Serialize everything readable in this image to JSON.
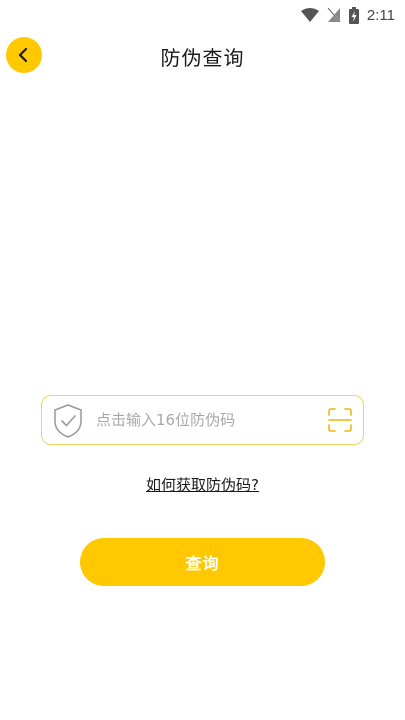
{
  "status_bar": {
    "time": "2:11",
    "icons": [
      "wifi-icon",
      "no-sim-icon",
      "battery-charging-icon"
    ]
  },
  "header": {
    "title": "防伪查询",
    "back_icon": "chevron-left-icon"
  },
  "form": {
    "code_input": {
      "placeholder": "点击输入16位防伪码",
      "value": "",
      "left_icon": "shield-check-icon",
      "right_icon": "scan-icon"
    },
    "help_link": "如何获取防伪码?",
    "submit_label": "查询"
  },
  "colors": {
    "accent": "#FFC800",
    "input_border": "#F0D260",
    "placeholder": "#A8A8A8"
  }
}
